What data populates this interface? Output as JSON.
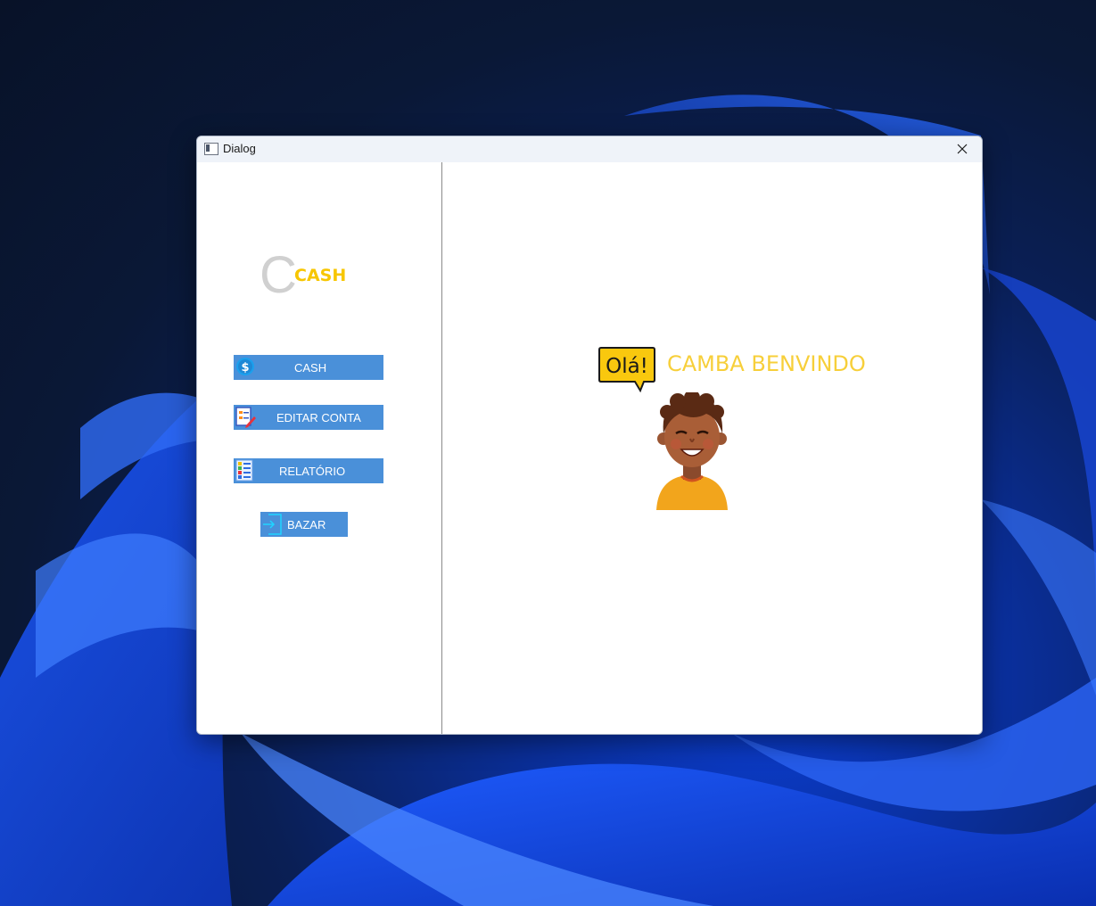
{
  "window": {
    "title": "Dialog",
    "close_icon": "close-icon"
  },
  "sidebar": {
    "logo": {
      "letter": "C",
      "word": "CASH"
    },
    "buttons": [
      {
        "label": "CASH",
        "icon": "dollar-coin-icon"
      },
      {
        "label": "EDITAR CONTA",
        "icon": "edit-document-icon"
      },
      {
        "label": "RELATÓRIO",
        "icon": "report-list-icon"
      },
      {
        "label": "BAZAR",
        "icon": "exit-door-icon"
      }
    ]
  },
  "main": {
    "speech_bubble": "Olá!",
    "welcome": "CAMBA BENVINDO",
    "avatar_icon": "smiling-person-avatar"
  },
  "colors": {
    "button_bg": "#4a90d9",
    "accent_yellow": "#f7c600",
    "welcome_yellow": "#f7cf3a",
    "logo_gray": "#d0d0d0"
  }
}
